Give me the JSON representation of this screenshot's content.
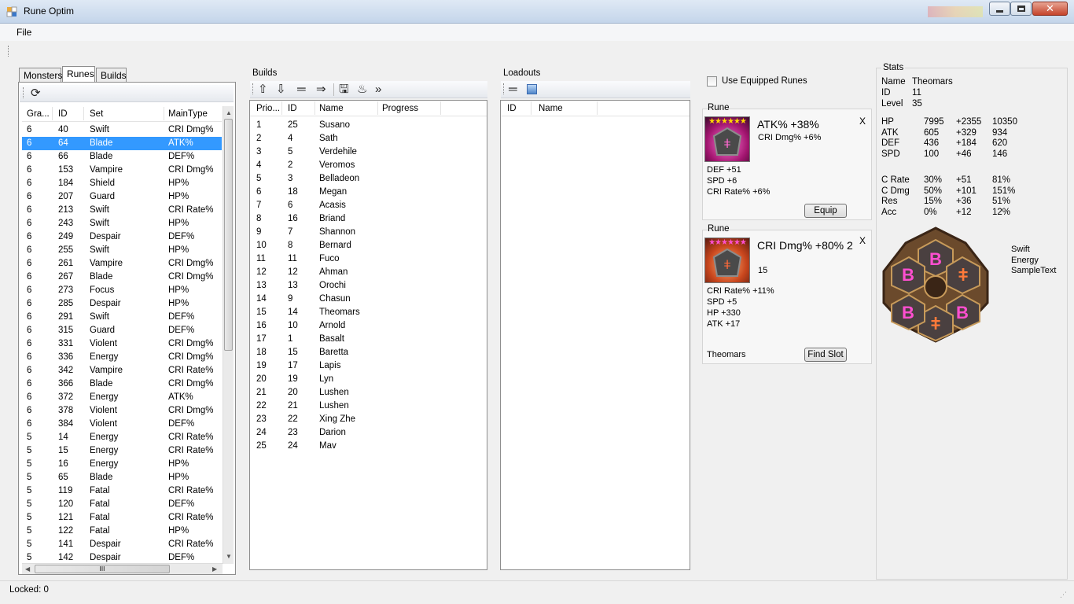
{
  "window": {
    "title": "Rune Optim"
  },
  "menu": {
    "file": "File"
  },
  "tabs": [
    "Monsters",
    "Runes",
    "Builds"
  ],
  "runes_grid": {
    "columns": [
      "Gra...",
      "ID",
      "Set",
      "MainType"
    ],
    "rows": [
      [
        "6",
        "40",
        "Swift",
        "CRI Dmg%"
      ],
      [
        "6",
        "64",
        "Blade",
        "ATK%"
      ],
      [
        "6",
        "66",
        "Blade",
        "DEF%"
      ],
      [
        "6",
        "153",
        "Vampire",
        "CRI Dmg%"
      ],
      [
        "6",
        "184",
        "Shield",
        "HP%"
      ],
      [
        "6",
        "207",
        "Guard",
        "HP%"
      ],
      [
        "6",
        "213",
        "Swift",
        "CRI Rate%"
      ],
      [
        "6",
        "243",
        "Swift",
        "HP%"
      ],
      [
        "6",
        "249",
        "Despair",
        "DEF%"
      ],
      [
        "6",
        "255",
        "Swift",
        "HP%"
      ],
      [
        "6",
        "261",
        "Vampire",
        "CRI Dmg%"
      ],
      [
        "6",
        "267",
        "Blade",
        "CRI Dmg%"
      ],
      [
        "6",
        "273",
        "Focus",
        "HP%"
      ],
      [
        "6",
        "285",
        "Despair",
        "HP%"
      ],
      [
        "6",
        "291",
        "Swift",
        "DEF%"
      ],
      [
        "6",
        "315",
        "Guard",
        "DEF%"
      ],
      [
        "6",
        "331",
        "Violent",
        "CRI Dmg%"
      ],
      [
        "6",
        "336",
        "Energy",
        "CRI Dmg%"
      ],
      [
        "6",
        "342",
        "Vampire",
        "CRI Rate%"
      ],
      [
        "6",
        "366",
        "Blade",
        "CRI Dmg%"
      ],
      [
        "6",
        "372",
        "Energy",
        "ATK%"
      ],
      [
        "6",
        "378",
        "Violent",
        "CRI Dmg%"
      ],
      [
        "6",
        "384",
        "Violent",
        "DEF%"
      ],
      [
        "5",
        "14",
        "Energy",
        "CRI Rate%"
      ],
      [
        "5",
        "15",
        "Energy",
        "CRI Rate%"
      ],
      [
        "5",
        "16",
        "Energy",
        "HP%"
      ],
      [
        "5",
        "65",
        "Blade",
        "HP%"
      ],
      [
        "5",
        "119",
        "Fatal",
        "CRI Rate%"
      ],
      [
        "5",
        "120",
        "Fatal",
        "DEF%"
      ],
      [
        "5",
        "121",
        "Fatal",
        "CRI Rate%"
      ],
      [
        "5",
        "122",
        "Fatal",
        "HP%"
      ],
      [
        "5",
        "141",
        "Despair",
        "CRI Rate%"
      ],
      [
        "5",
        "142",
        "Despair",
        "DEF%"
      ]
    ],
    "selected_index": 1
  },
  "builds": {
    "label": "Builds",
    "columns": [
      "Prio...",
      "ID",
      "Name",
      "Progress"
    ],
    "rows": [
      [
        "1",
        "25",
        "Susano"
      ],
      [
        "2",
        "4",
        "Sath"
      ],
      [
        "3",
        "5",
        "Verdehile"
      ],
      [
        "4",
        "2",
        "Veromos"
      ],
      [
        "5",
        "3",
        "Belladeon"
      ],
      [
        "6",
        "18",
        "Megan"
      ],
      [
        "7",
        "6",
        "Acasis"
      ],
      [
        "8",
        "16",
        "Briand"
      ],
      [
        "9",
        "7",
        "Shannon"
      ],
      [
        "10",
        "8",
        "Bernard"
      ],
      [
        "11",
        "11",
        "Fuco"
      ],
      [
        "12",
        "12",
        "Ahman"
      ],
      [
        "13",
        "13",
        "Orochi"
      ],
      [
        "14",
        "9",
        "Chasun"
      ],
      [
        "15",
        "14",
        "Theomars"
      ],
      [
        "16",
        "10",
        "Arnold"
      ],
      [
        "17",
        "1",
        "Basalt"
      ],
      [
        "18",
        "15",
        "Baretta"
      ],
      [
        "19",
        "17",
        "Lapis"
      ],
      [
        "20",
        "19",
        "Lyn"
      ],
      [
        "21",
        "20",
        "Lushen"
      ],
      [
        "22",
        "21",
        "Lushen"
      ],
      [
        "23",
        "22",
        "Xing Zhe"
      ],
      [
        "24",
        "23",
        "Darion"
      ],
      [
        "25",
        "24",
        "Mav"
      ]
    ]
  },
  "loadouts": {
    "label": "Loadouts",
    "columns": [
      "ID",
      "Name"
    ]
  },
  "use_equipped": "Use Equipped Runes",
  "rune1": {
    "label": "Rune",
    "main": "ATK% +38%",
    "innate": "CRI Dmg% +6%",
    "subs": [
      "DEF +51",
      "SPD +6",
      "CRI Rate% +6%"
    ],
    "close": "X",
    "button": "Equip",
    "stars": "★★★★★★"
  },
  "rune2": {
    "label": "Rune",
    "main": "CRI Dmg% +80% 2",
    "level": "15",
    "subs": [
      "CRI Rate% +11%",
      "SPD +5",
      "HP +330",
      "ATK +17"
    ],
    "close": "X",
    "owner": "Theomars",
    "button": "Find Slot",
    "stars": "★★★★★★"
  },
  "stats": {
    "label": "Stats",
    "name_label": "Name",
    "name": "Theomars",
    "id_label": "ID",
    "id": "11",
    "level_label": "Level",
    "level": "35",
    "rows": [
      [
        "HP",
        "7995",
        "+2355",
        "10350"
      ],
      [
        "ATK",
        "605",
        "+329",
        "934"
      ],
      [
        "DEF",
        "436",
        "+184",
        "620"
      ],
      [
        "SPD",
        "100",
        "+46",
        "146"
      ]
    ],
    "rows2": [
      [
        "C Rate",
        "30%",
        "+51",
        "81%"
      ],
      [
        "C Dmg",
        "50%",
        "+101",
        "151%"
      ],
      [
        "Res",
        "15%",
        "+36",
        "51%"
      ],
      [
        "Acc",
        "0%",
        "+12",
        "12%"
      ]
    ],
    "sets": [
      "Swift",
      "Energy",
      "SampleText"
    ]
  },
  "grid_scroll_thumb": "III",
  "status": {
    "locked": "Locked: 0"
  },
  "colors": {
    "selection": "#3399ff",
    "rune_glyph": "#ff4fd0"
  },
  "icons": [
    "refresh-icon",
    "move-up-icon",
    "move-down-icon",
    "equals-icon",
    "arrow-right-icon",
    "save-icon",
    "fire-icon",
    "double-chevron-icon",
    "image-icon"
  ]
}
